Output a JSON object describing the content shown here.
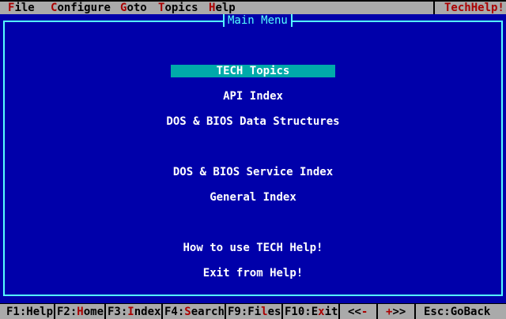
{
  "menubar": {
    "items": [
      {
        "hot": "F",
        "rest": "ile"
      },
      {
        "hot": "C",
        "rest": "onfigure"
      },
      {
        "hot": "G",
        "rest": "oto"
      },
      {
        "hot": "T",
        "rest": "opics"
      },
      {
        "hot": "H",
        "rest": "elp"
      }
    ],
    "brand": "TechHelp!"
  },
  "window": {
    "title": "Main Menu"
  },
  "menu": {
    "selected_index": 0,
    "items": [
      "TECH Topics",
      "API Index",
      "DOS & BIOS Data Structures",
      "DOS & BIOS Service Index",
      "General Index",
      "How to use TECH Help!",
      "Exit from Help!"
    ]
  },
  "statusbar": {
    "keys": [
      {
        "key": "F1",
        "sep": ":",
        "pre": "",
        "hot": "",
        "post": "Help"
      },
      {
        "key": "F2",
        "sep": ":",
        "pre": "",
        "hot": "H",
        "post": "ome"
      },
      {
        "key": "F3",
        "sep": ":",
        "pre": "",
        "hot": "I",
        "post": "ndex"
      },
      {
        "key": "F4",
        "sep": ":",
        "pre": "",
        "hot": "S",
        "post": "earch"
      },
      {
        "key": "F9",
        "sep": ":",
        "pre": "Fi",
        "hot": "l",
        "post": "es"
      },
      {
        "key": "F10",
        "sep": ":",
        "pre": "E",
        "hot": "x",
        "post": "it"
      },
      {
        "key": "<<",
        "sep": "",
        "pre": "",
        "hot": "-",
        "post": ""
      },
      {
        "key": "",
        "sep": "",
        "pre": "",
        "hot": "+",
        "post": ">>"
      },
      {
        "key": "Esc",
        "sep": ":",
        "pre": "",
        "hot": "",
        "post": "GoBack"
      }
    ]
  },
  "colors": {
    "background": "#0000aa",
    "frame": "#55ffff",
    "highlight": "#00aaaa",
    "bar": "#aaaaaa",
    "hotkey": "#aa0000"
  }
}
